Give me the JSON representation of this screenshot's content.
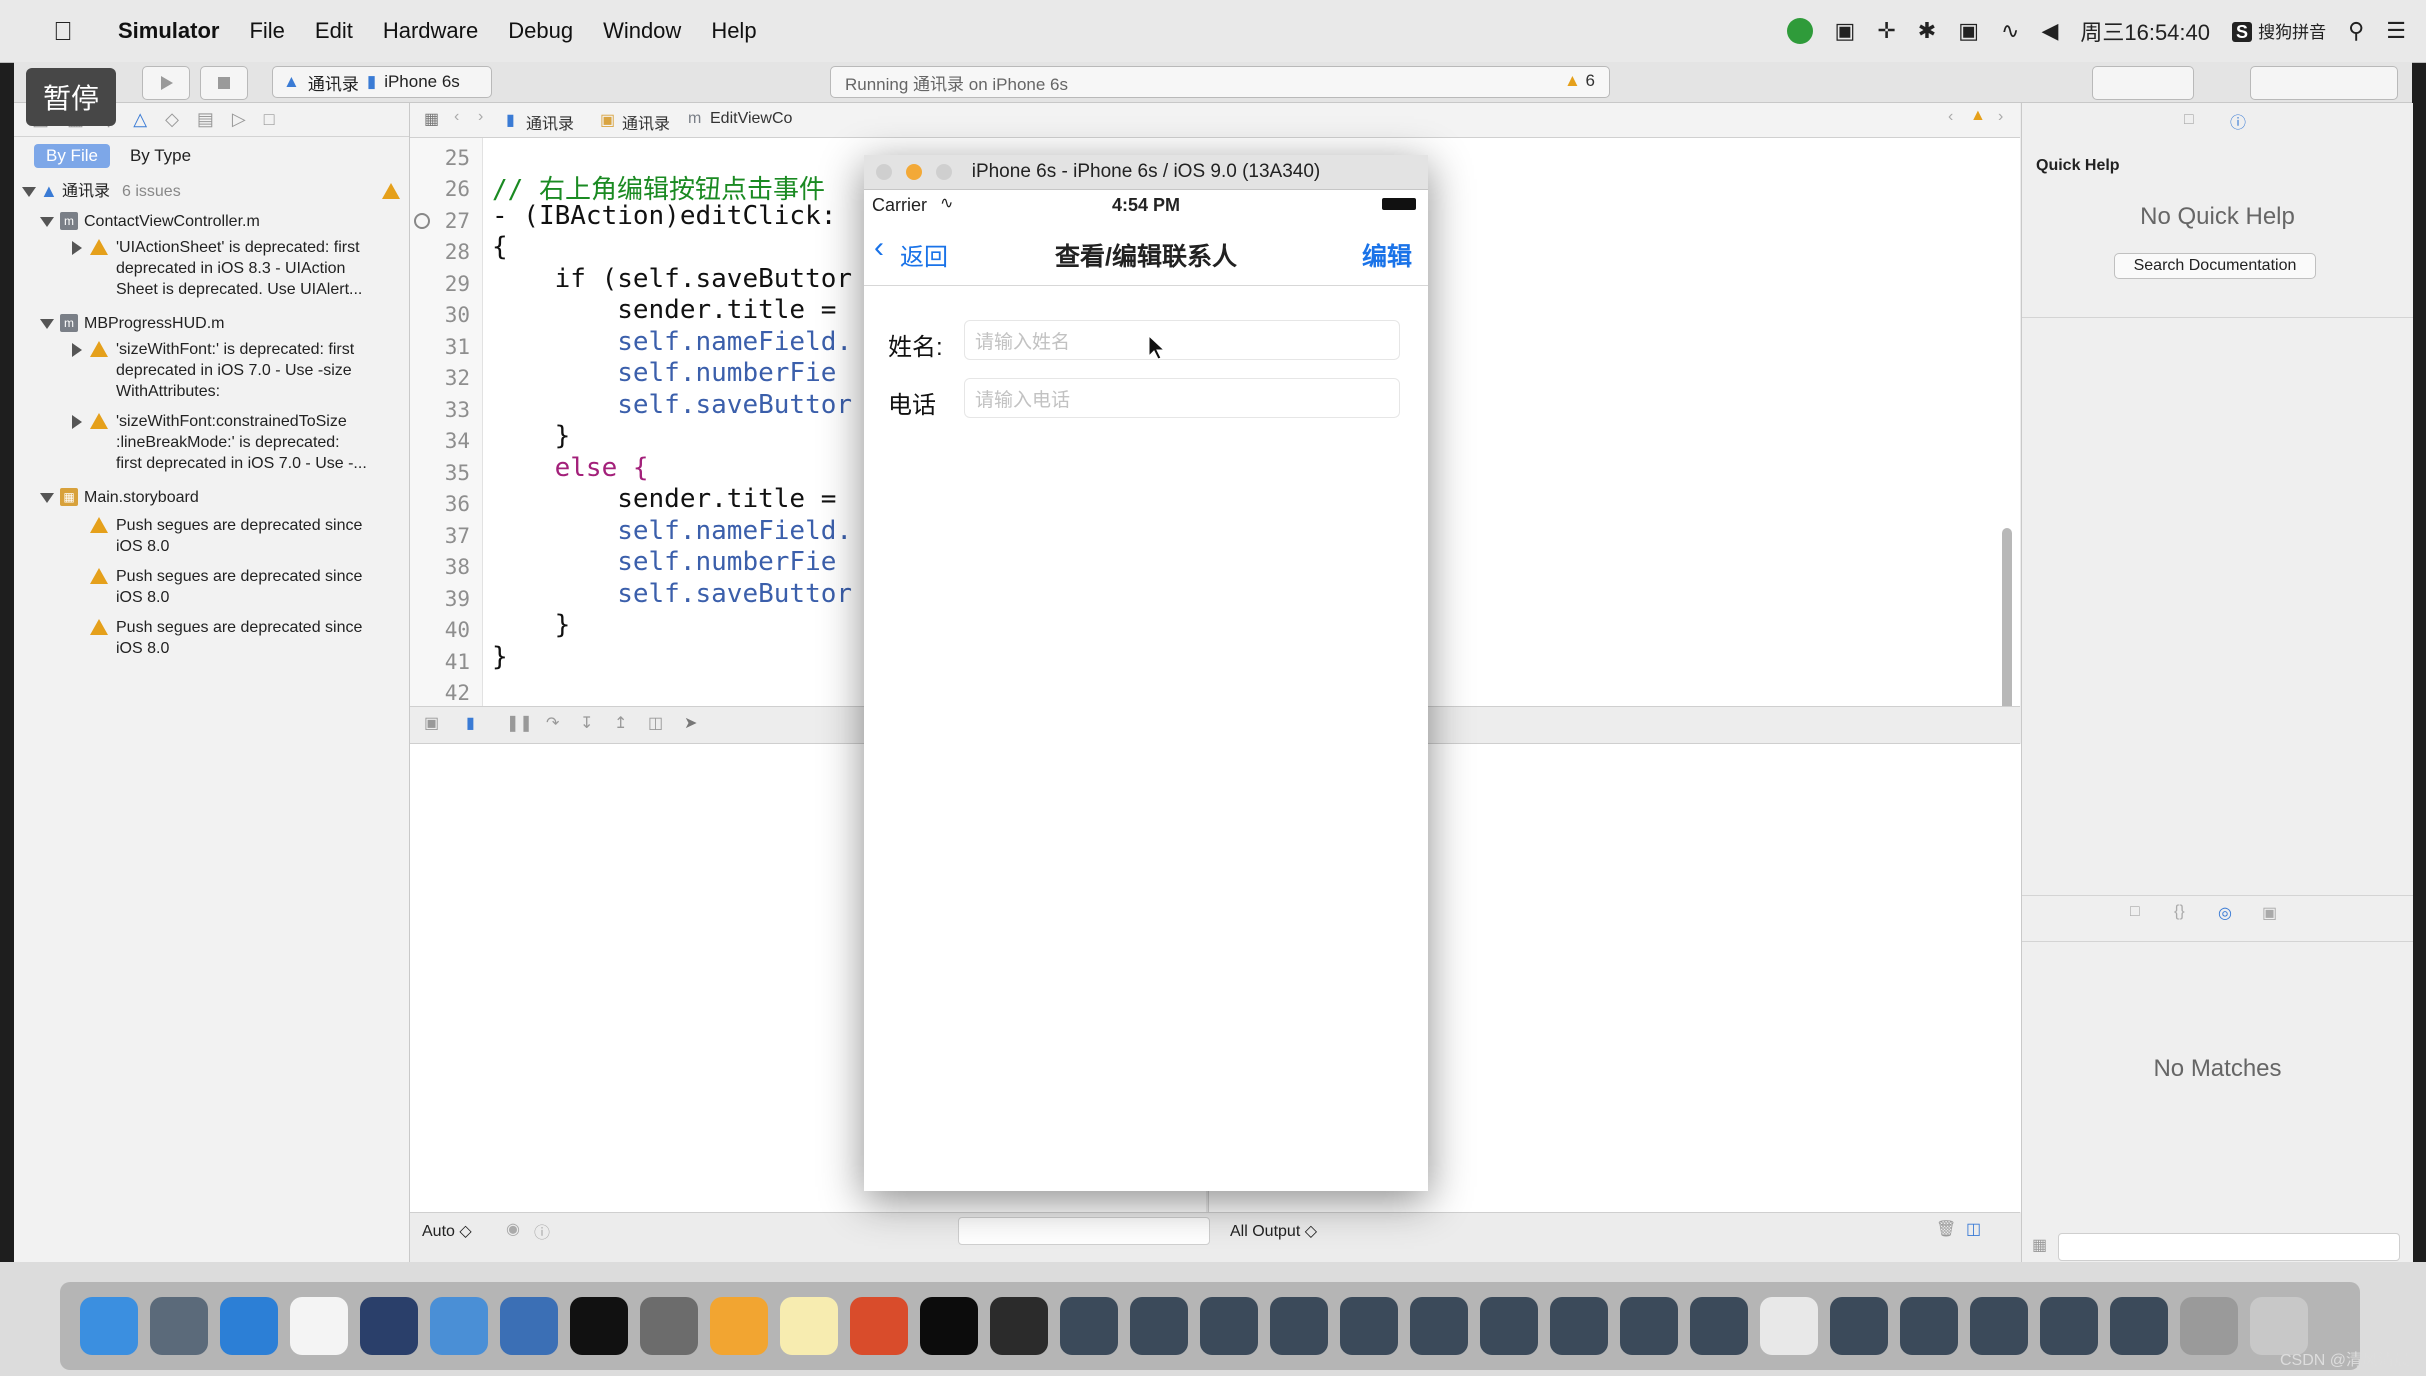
{
  "menubar": {
    "app": "Simulator",
    "items": [
      "File",
      "Edit",
      "Hardware",
      "Debug",
      "Window",
      "Help"
    ],
    "clock": "周三16:54:40",
    "ime": "搜狗拼音"
  },
  "overlay": {
    "pause_label": "暂停"
  },
  "toolbar": {
    "scheme": "通讯录",
    "device": "iPhone 6s",
    "status": "Running 通讯录 on iPhone 6s",
    "warning_count": "6"
  },
  "navigator": {
    "tab_by_file": "By File",
    "tab_by_type": "By Type",
    "project": "通讯录",
    "project_issues": "6 issues",
    "files": [
      {
        "name": "ContactViewController.m",
        "issues": [
          "'UIActionSheet' is deprecated: first",
          "deprecated in iOS 8.3 - UIAction",
          "Sheet is deprecated. Use UIAlert..."
        ]
      },
      {
        "name": "MBProgressHUD.m",
        "issues": [
          "'sizeWithFont:' is deprecated: first",
          "deprecated in iOS 7.0 - Use -size",
          "WithAttributes:"
        ],
        "issues2": [
          "'sizeWithFont:constrainedToSize",
          ":lineBreakMode:' is deprecated:",
          "first deprecated in iOS 7.0 - Use -..."
        ]
      },
      {
        "name": "Main.storyboard",
        "issues": [
          "Push segues are deprecated since",
          "iOS 8.0"
        ]
      }
    ]
  },
  "jumpbar": {
    "crumbs": [
      "通讯录",
      "通讯录",
      "EditViewCo"
    ]
  },
  "code": {
    "lines": [
      {
        "n": "25",
        "t": ""
      },
      {
        "n": "26",
        "t": "// 右上角编辑按钮点击事件"
      },
      {
        "n": "27",
        "t": "- (IBAction)editClick:"
      },
      {
        "n": "28",
        "t": "{"
      },
      {
        "n": "29",
        "t": "    if (self.saveButtor"
      },
      {
        "n": "30",
        "t": "        sender.title ="
      },
      {
        "n": "31",
        "t": "        self.nameField."
      },
      {
        "n": "32",
        "t": "        self.numberFie"
      },
      {
        "n": "33",
        "t": "        self.saveButtor"
      },
      {
        "n": "34",
        "t": "    }"
      },
      {
        "n": "35",
        "t": "    else {"
      },
      {
        "n": "36",
        "t": "        sender.title ="
      },
      {
        "n": "37",
        "t": "        self.nameField."
      },
      {
        "n": "38",
        "t": "        self.numberFie"
      },
      {
        "n": "39",
        "t": "        self.saveButtor"
      },
      {
        "n": "40",
        "t": "    }"
      },
      {
        "n": "41",
        "t": "}"
      },
      {
        "n": "42",
        "t": ""
      }
    ]
  },
  "bottombar": {
    "auto": "Auto ◇",
    "all_output": "All Output ◇"
  },
  "inspector": {
    "quick_help_title": "Quick Help",
    "no_quick_help": "No Quick Help",
    "search_doc": "Search Documentation",
    "no_matches": "No Matches"
  },
  "simulator": {
    "title": "iPhone 6s - iPhone 6s / iOS 9.0 (13A340)",
    "carrier": "Carrier",
    "time": "4:54 PM",
    "back": "返回",
    "nav_title": "查看/编辑联系人",
    "edit": "编辑",
    "name_label": "姓名:",
    "name_placeholder": "请输入姓名",
    "phone_label": "电话",
    "phone_placeholder": "请输入电话"
  },
  "watermark": "CSDN @清风清晨"
}
